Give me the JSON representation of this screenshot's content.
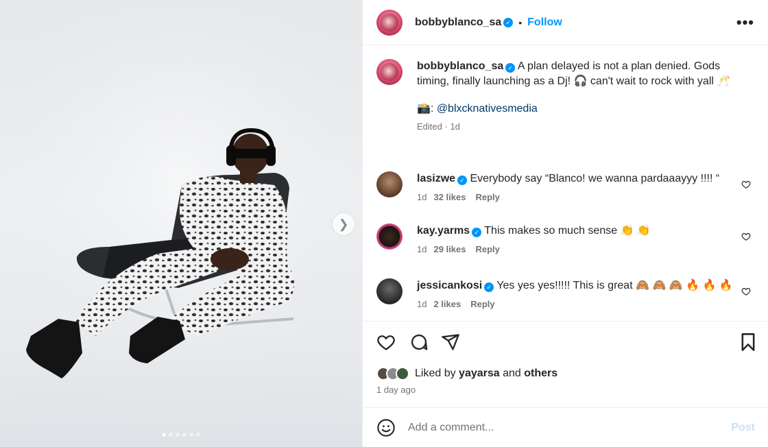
{
  "post": {
    "username": "bobbyblanco_sa",
    "follow_label": "Follow",
    "separator": "•",
    "more_label": "•••",
    "caption": {
      "text": "A plan delayed is not a plan denied. Gods timing, finally launching as a Dj! 🎧 can't wait to rock with yall 🥂",
      "credit_prefix": "📸: ",
      "credit_mention": "@blxcknativesmedia",
      "edited": "Edited",
      "time": "1d"
    },
    "comments": [
      {
        "username": "lasizwe",
        "text": "Everybody say “Blanco! we wanna pardaaayyy !!!! “",
        "time": "1d",
        "likes": "32 likes",
        "reply": "Reply"
      },
      {
        "username": "kay.yarms",
        "text": "This makes so much sense 👏 👏",
        "time": "1d",
        "likes": "29 likes",
        "reply": "Reply"
      },
      {
        "username": "jessicankosi",
        "text": "Yes yes yes!!!!! This is great 🙈 🙈 🙈 🔥 🔥 🔥",
        "time": "1d",
        "likes": "2 likes",
        "reply": "Reply"
      }
    ],
    "liked_by": {
      "prefix": "Liked by ",
      "user": "yayarsa",
      "middle": " and ",
      "others": "others"
    },
    "posted_ago": "1 day ago",
    "add_comment_placeholder": "Add a comment...",
    "post_label": "Post",
    "carousel": {
      "count": 6,
      "active_index": 0
    }
  },
  "colors": {
    "accent": "#0095f6",
    "text": "#262626",
    "muted": "#737373",
    "post_disabled": "#c7e3fb"
  },
  "icons": [
    "verified-badge-icon",
    "more-options-icon",
    "heart-icon",
    "comment-icon",
    "share-icon",
    "bookmark-icon",
    "emoji-icon",
    "chevron-right-icon"
  ]
}
